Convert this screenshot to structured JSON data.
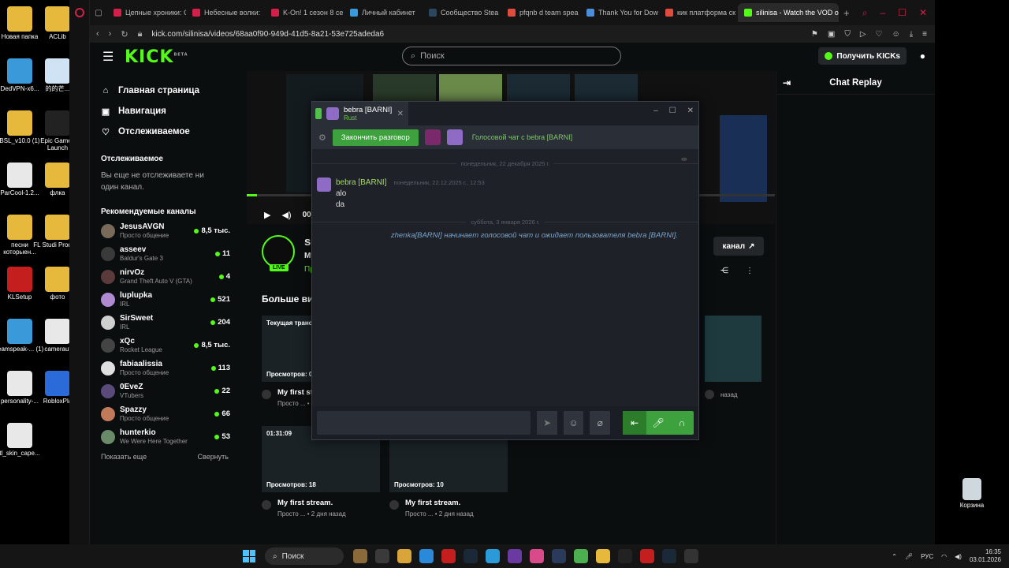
{
  "desktop": {
    "left_icons": [
      {
        "label": "Новая папка",
        "color": "#e6b93c"
      },
      {
        "label": "ACLib",
        "color": "#e6b93c"
      },
      {
        "label": "DedVPN-x6...",
        "color": "#3a9ad9"
      },
      {
        "label": "的的芒...",
        "color": "#cfe3f5"
      },
      {
        "label": "BSL_v10.0 (1)",
        "color": "#e6b93c"
      },
      {
        "label": "Epic Games Launch",
        "color": "#222222"
      },
      {
        "label": "ParCool-1.2...",
        "color": "#e8e8e8"
      },
      {
        "label": "флка",
        "color": "#e6b93c"
      },
      {
        "label": "песни которыен...",
        "color": "#e6b93c"
      },
      {
        "label": "FL Studi Produce",
        "color": "#e6b93c"
      },
      {
        "label": "KLSetup",
        "color": "#c41e1e"
      },
      {
        "label": "фото",
        "color": "#e6b93c"
      },
      {
        "label": "teamspeak-... (1)",
        "color": "#3a9ad9"
      },
      {
        "label": "cameraut",
        "color": "#e8e8e8"
      },
      {
        "label": "personality-...",
        "color": "#e8e8e8"
      },
      {
        "label": "RobloxPla",
        "color": "#2a6bd9"
      },
      {
        "label": "tl_skin_cape...",
        "color": "#e8e8e8"
      }
    ],
    "recycle_bin": "Корзина"
  },
  "browser": {
    "tabs": [
      {
        "label": "Цепные хроники: С",
        "color": "#d3204a"
      },
      {
        "label": "Небесные волки:",
        "color": "#d3204a"
      },
      {
        "label": "K-On! 1 сезон 8 се",
        "color": "#d3204a"
      },
      {
        "label": "Личный кабинет",
        "color": "#3a9ad9"
      },
      {
        "label": "Сообщество Stea",
        "color": "#2a475e"
      },
      {
        "label": "pfqnb d team spea",
        "color": "#e04a3f"
      },
      {
        "label": "Thank You for Dow",
        "color": "#4c8dd9"
      },
      {
        "label": "кик платформа ск",
        "color": "#e04a3f"
      },
      {
        "label": "silinisa - Watch the VOD o",
        "color": "#53fc18"
      }
    ],
    "url": "kick.com/silinisa/videos/68aa0f90-949d-41d5-8a21-53e725adeda6"
  },
  "kick": {
    "search_placeholder": "Поиск",
    "get_kicks": "Получить KICKs",
    "nav": [
      {
        "label": "Главная страница",
        "icon": "⌂"
      },
      {
        "label": "Навигация",
        "icon": "▣"
      },
      {
        "label": "Отслеживаемое",
        "icon": "♡"
      }
    ],
    "following_header": "Отслеживаемое",
    "following_empty": "Вы еще не отслеживаете ни один канал.",
    "recommended_header": "Рекомендуемые каналы",
    "channels": [
      {
        "name": "JesusAVGN",
        "category": "Просто общение",
        "viewers": "8,5 тыс.",
        "color": "#7a6a5a"
      },
      {
        "name": "asseev",
        "category": "Baldur's Gate 3",
        "viewers": "11",
        "color": "#3a3a3a"
      },
      {
        "name": "nirvOz",
        "category": "Grand Theft Auto V (GTA)",
        "viewers": "4",
        "color": "#5a3a3a"
      },
      {
        "name": "luplupka",
        "category": "IRL",
        "viewers": "521",
        "color": "#b08ad0"
      },
      {
        "name": "SirSweet",
        "category": "IRL",
        "viewers": "204",
        "color": "#cfcfcf"
      },
      {
        "name": "xQc",
        "category": "Rocket League",
        "viewers": "8,5 тыс.",
        "color": "#444444"
      },
      {
        "name": "fabiaalissia",
        "category": "Просто общение",
        "viewers": "113",
        "color": "#e0e0e0"
      },
      {
        "name": "0EveZ",
        "category": "VTubers",
        "viewers": "22",
        "color": "#5a4a7a"
      },
      {
        "name": "Spazzy",
        "category": "Просто общение",
        "viewers": "66",
        "color": "#c07a5a"
      },
      {
        "name": "hunterkio",
        "category": "We Were Here Together",
        "viewers": "53",
        "color": "#6a8a6a"
      }
    ],
    "show_more": "Показать еще",
    "collapse": "Свернуть",
    "player_time": "00:02",
    "streamer": {
      "name": "silinis",
      "title": "My first",
      "category": "Просто",
      "live": "LIVE"
    },
    "channel_button": "канал",
    "more_videos": "Больше видео",
    "videos": [
      {
        "top": "Текущая трансляция",
        "views": "Просмотров: 0",
        "title": "My first stream.",
        "sub": "Просто ... • 1 мину"
      },
      {
        "top": "01:31:09",
        "views": "Просмотров: 18",
        "title": "My first stream.",
        "sub": "Просто ... • 2 дня назад"
      },
      {
        "top": "",
        "views": "Просмотров: 10",
        "title": "My first stream.",
        "sub": "Просто ... • 2 дня назад"
      },
      {
        "top": "",
        "views": "",
        "title": "",
        "sub": "назад"
      }
    ],
    "chat_replay": "Chat Replay"
  },
  "steam": {
    "tab_name": "bebra [BARNI]",
    "tab_game": "Rust",
    "end_call": "Закончить разговор",
    "voice_text": "Голосовой чат с bebra [BARNI]",
    "date1": "понедельник, 22 декабря 2025 г.",
    "msg_author": "bebra [BARNI]",
    "msg_time": "понедельник, 22.12.2025 г., 12:53",
    "messages": [
      "alo",
      "da"
    ],
    "date2": "суббота, 3 января 2026 г.",
    "system_message": "zhenka[BARNI] начинает голосовой чат и ожидает пользователя bebra [BARNI]."
  },
  "taskbar": {
    "search": "Поиск",
    "lang": "РУС",
    "time": "16:35",
    "date": "03.01.2026",
    "app_colors": [
      "#8a6a3a",
      "#3a3a3a",
      "#d9a53a",
      "#2a8ad9",
      "#c41e1e",
      "#1b2838",
      "#2a9ad9",
      "#6a3aa0",
      "#d94a8a",
      "#2a3a5a",
      "#4caf50",
      "#e6b93c",
      "#222222",
      "#c41e1e",
      "#1b2838",
      "#333333"
    ]
  }
}
